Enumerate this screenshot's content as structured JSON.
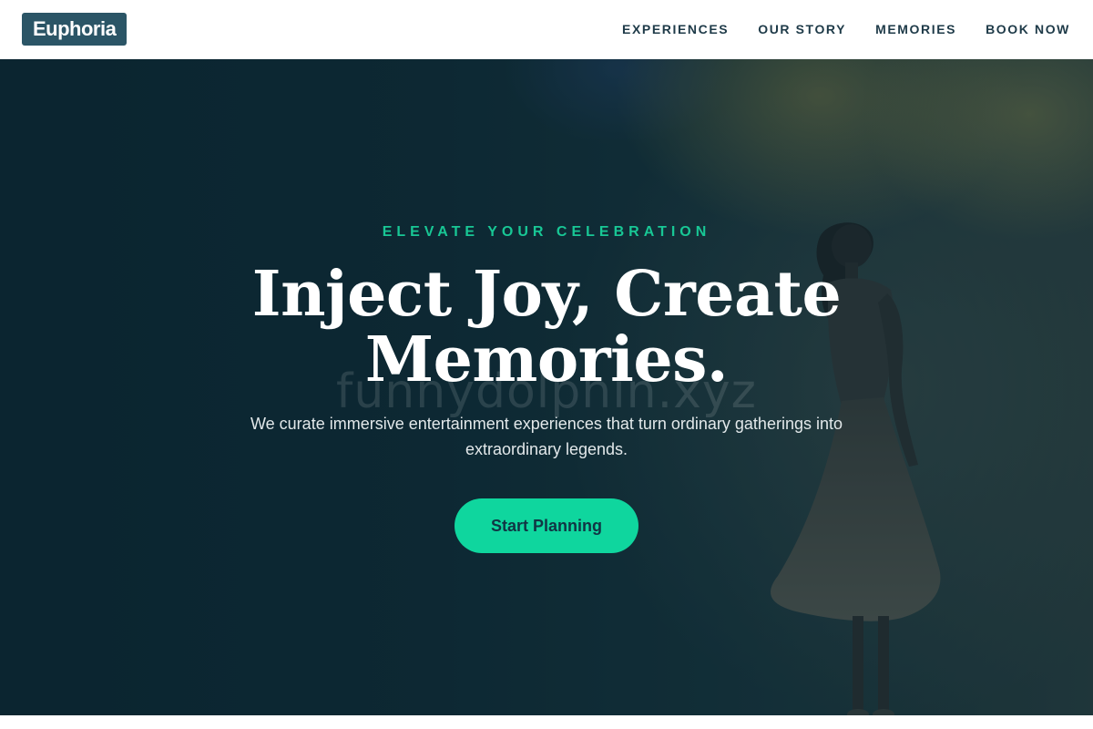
{
  "header": {
    "logo": "Euphoria",
    "nav": [
      {
        "label": "EXPERIENCES"
      },
      {
        "label": "OUR STORY"
      },
      {
        "label": "MEMORIES"
      },
      {
        "label": "BOOK NOW"
      }
    ]
  },
  "hero": {
    "eyebrow": "ELEVATE YOUR CELEBRATION",
    "headline_line1": "Inject Joy, Create",
    "headline_line2": "Memories.",
    "subtitle": "We curate immersive entertainment experiences that turn ordinary gatherings into extraordinary legends.",
    "cta_label": "Start Planning",
    "watermark": "funnydolphin.xyz"
  },
  "colors": {
    "brand": "#2b5566",
    "accent": "#0fd69e",
    "eyebrow": "#18c795",
    "nav_text": "#1e3a48"
  }
}
